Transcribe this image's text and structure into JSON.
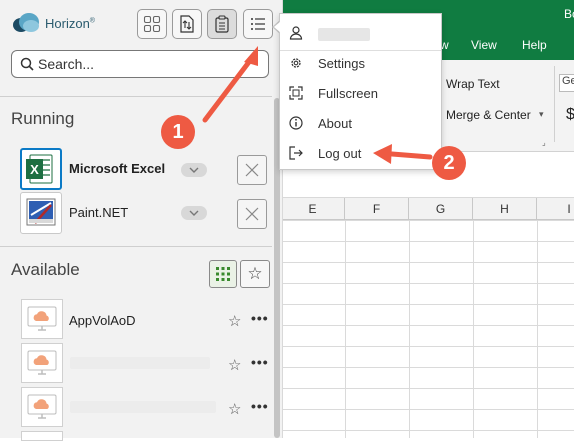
{
  "brand": {
    "name": "Horizon",
    "mark": "®"
  },
  "search": {
    "placeholder": "Search..."
  },
  "sections": {
    "running": "Running",
    "available": "Available"
  },
  "running_apps": [
    {
      "name": "Microsoft Excel",
      "bold": true,
      "selected": true
    },
    {
      "name": "Paint.NET",
      "bold": false,
      "selected": false
    }
  ],
  "available_apps": [
    {
      "name": "AppVolAoD"
    },
    {
      "name": ""
    },
    {
      "name": ""
    }
  ],
  "menu": {
    "items": [
      {
        "label": "Settings",
        "icon": "gear-icon"
      },
      {
        "label": "Fullscreen",
        "icon": "fullscreen-icon"
      },
      {
        "label": "About",
        "icon": "info-icon"
      },
      {
        "label": "Log out",
        "icon": "logout-icon"
      }
    ]
  },
  "callouts": {
    "step1": "1",
    "step2": "2"
  },
  "excel": {
    "title_fragment": "Bo",
    "tabs": [
      "w",
      "View",
      "Help"
    ],
    "ribbon": {
      "wrap_text": "Wrap Text",
      "merge_center": "Merge & Center",
      "number_format": "Ge",
      "currency": "$"
    },
    "columns": [
      "E",
      "F",
      "G",
      "H",
      "I"
    ]
  },
  "colors": {
    "excel_green": "#107c41",
    "excel_icon": "#1d6f42",
    "callout_red": "#ee5a43",
    "selection_blue": "#0b7ac6",
    "cloud_orange": "#f2a27a"
  }
}
